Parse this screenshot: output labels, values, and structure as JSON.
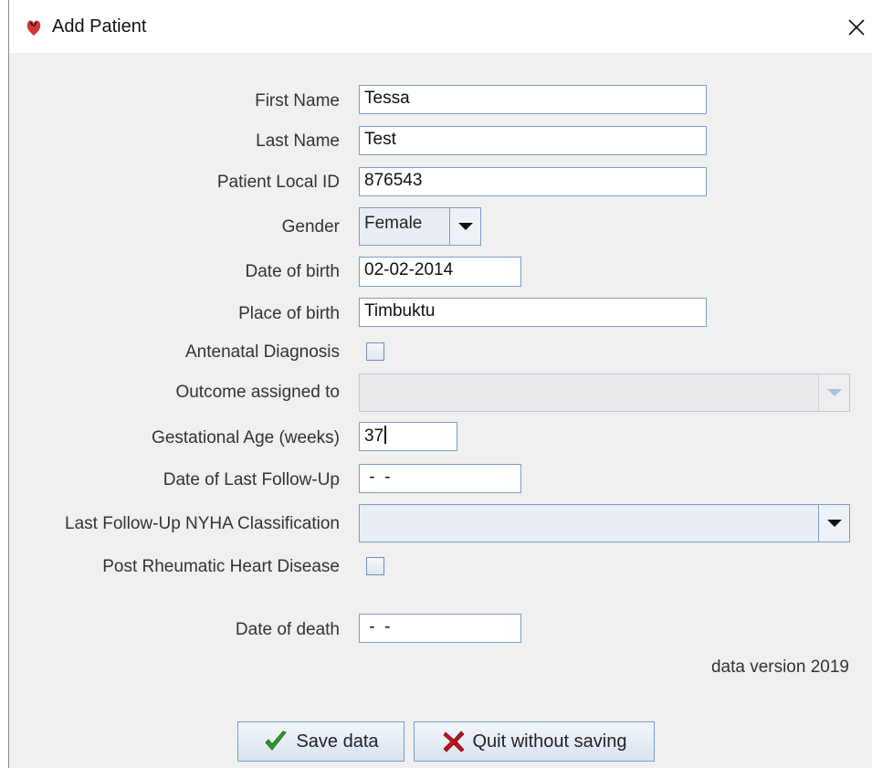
{
  "window": {
    "title": "Add Patient"
  },
  "form": {
    "first_name": {
      "label": "First Name",
      "value": "Tessa"
    },
    "last_name": {
      "label": "Last Name",
      "value": "Test"
    },
    "local_id": {
      "label": "Patient Local ID",
      "value": "876543"
    },
    "gender": {
      "label": "Gender",
      "value": "Female"
    },
    "dob": {
      "label": "Date of birth",
      "value": "02-02-2014"
    },
    "pob": {
      "label": "Place of birth",
      "value": "Timbuktu"
    },
    "antenatal": {
      "label": "Antenatal Diagnosis",
      "checked": false
    },
    "outcome": {
      "label": "Outcome assigned to",
      "value": ""
    },
    "gestational_age": {
      "label": "Gestational Age (weeks)",
      "value": "37"
    },
    "last_followup": {
      "label": "Date of Last Follow-Up",
      "value": " -  - "
    },
    "nyha": {
      "label": "Last Follow-Up NYHA Classification",
      "value": ""
    },
    "post_rheumatic": {
      "label": "Post Rheumatic Heart Disease",
      "checked": false
    },
    "date_of_death": {
      "label": "Date of death",
      "value": " -  - "
    }
  },
  "footer": {
    "data_version": "data version 2019",
    "save_label": "Save data",
    "quit_label": "Quit without saving"
  },
  "icons": {
    "app": "heart-app-icon",
    "close": "close-icon",
    "save": "checkmark-icon",
    "quit": "x-icon"
  },
  "colors": {
    "field_border": "#7a9cc6",
    "panel_bg": "#f0f0f0",
    "check_green": "#2e9b2e",
    "x_red": "#c0121b"
  }
}
